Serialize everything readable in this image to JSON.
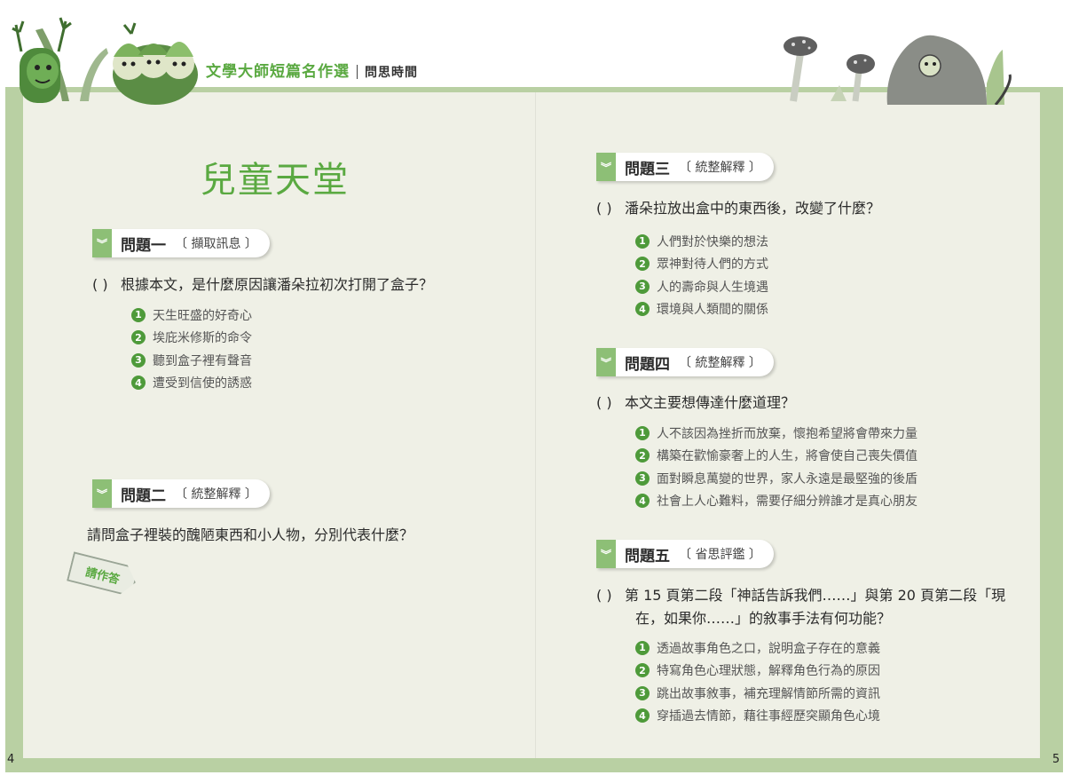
{
  "header": {
    "book_title": "文學大師短篇名作選",
    "section": "問思時間"
  },
  "page_title": "兒童天堂",
  "left_page_number": "4",
  "right_page_number": "5",
  "answer_tag": "請作答",
  "paren": "(    )",
  "q1": {
    "title": "問題一",
    "tag": "〔 擷取訊息 〕",
    "question": "根據本文，是什麼原因讓潘朵拉初次打開了盒子？",
    "options": [
      {
        "n": "1",
        "text": "天生旺盛的好奇心"
      },
      {
        "n": "2",
        "text": "埃庇米修斯的命令"
      },
      {
        "n": "3",
        "text": "聽到盒子裡有聲音"
      },
      {
        "n": "4",
        "text": "遭受到信使的誘惑"
      }
    ]
  },
  "q2": {
    "title": "問題二",
    "tag": "〔 統整解釋 〕",
    "question": "請問盒子裡裝的醜陋東西和小人物，分別代表什麼？"
  },
  "q3": {
    "title": "問題三",
    "tag": "〔 統整解釋 〕",
    "question": "潘朵拉放出盒中的東西後，改變了什麼？",
    "options": [
      {
        "n": "1",
        "text": "人們對於快樂的想法"
      },
      {
        "n": "2",
        "text": "眾神對待人們的方式"
      },
      {
        "n": "3",
        "text": "人的壽命與人生境遇"
      },
      {
        "n": "4",
        "text": "環境與人類間的關係"
      }
    ]
  },
  "q4": {
    "title": "問題四",
    "tag": "〔 統整解釋 〕",
    "question": "本文主要想傳達什麼道理？",
    "options": [
      {
        "n": "1",
        "text": "人不該因為挫折而放棄，懷抱希望將會帶來力量"
      },
      {
        "n": "2",
        "text": "構築在歡愉豪奢上的人生，將會使自己喪失價值"
      },
      {
        "n": "3",
        "text": "面對瞬息萬變的世界，家人永遠是最堅強的後盾"
      },
      {
        "n": "4",
        "text": "社會上人心難料，需要仔細分辨誰才是真心朋友"
      }
    ]
  },
  "q5": {
    "title": "問題五",
    "tag": "〔 省思評鑑 〕",
    "question_line1": "第 15 頁第二段「神話告訴我們……」與第 20 頁第二段「現",
    "question_line2": "在，如果你……」的敘事手法有何功能？",
    "options": [
      {
        "n": "1",
        "text": "透過故事角色之口，說明盒子存在的意義"
      },
      {
        "n": "2",
        "text": "特寫角色心理狀態，解釋角色行為的原因"
      },
      {
        "n": "3",
        "text": "跳出故事敘事，補充理解情節所需的資訊"
      },
      {
        "n": "4",
        "text": "穿插過去情節，藉往事經歷突顯角色心境"
      }
    ]
  }
}
